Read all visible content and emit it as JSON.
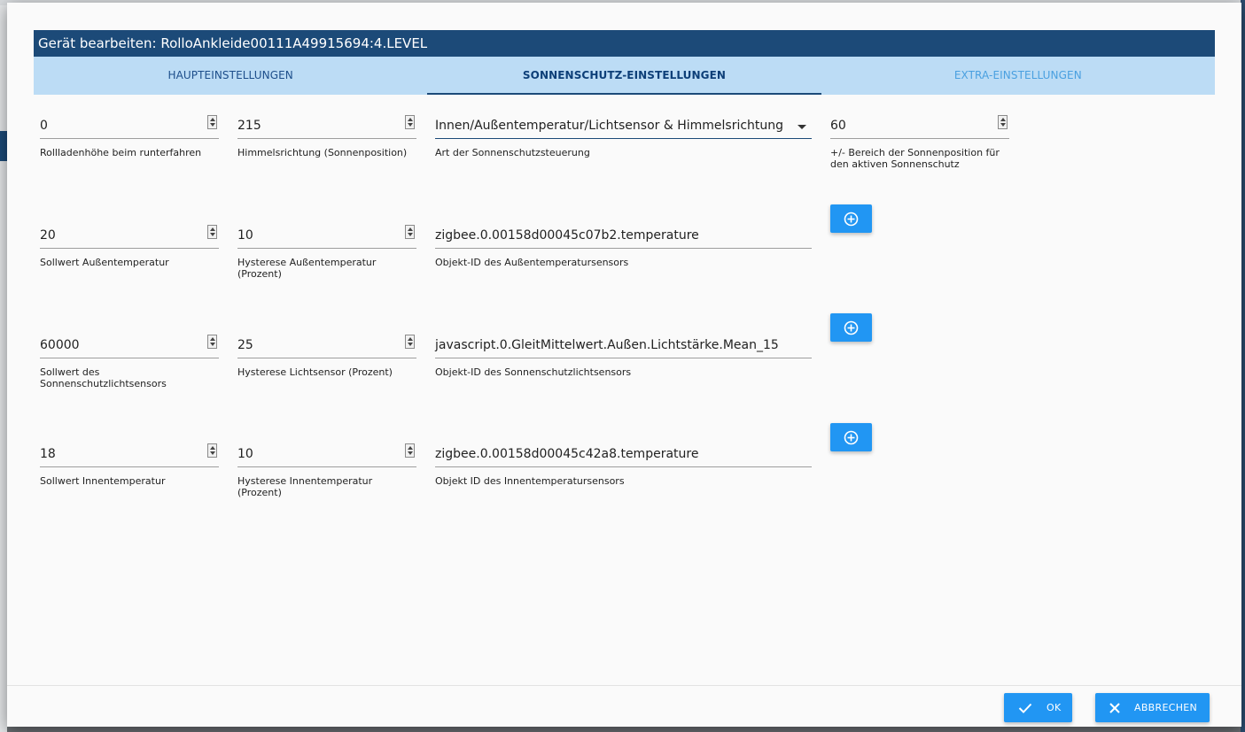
{
  "dialog": {
    "title": "Gerät bearbeiten: RolloAnkleide00111A49915694:4.LEVEL"
  },
  "tabs": [
    {
      "label": "HAUPTEINSTELLUNGEN"
    },
    {
      "label": "SONNENSCHUTZ-EINSTELLUNGEN"
    },
    {
      "label": "EXTRA-EINSTELLUNGEN"
    }
  ],
  "fields": {
    "height_down": {
      "value": "0",
      "label": "Rollladenhöhe beim runterfahren"
    },
    "sun_direction": {
      "value": "215",
      "label": "Himmelsrichtung (Sonnenposition)"
    },
    "sunprotect_mode": {
      "value": "Innen/Außentemperatur/Lichtsensor & Himmelsrichtung",
      "label": "Art der Sonnenschutzsteuerung"
    },
    "sun_range": {
      "value": "60",
      "label": "+/- Bereich der Sonnenposition für den aktiven Sonnenschutz"
    },
    "outside_temp_setpoint": {
      "value": "20",
      "label": "Sollwert Außentemperatur"
    },
    "outside_temp_hysteresis": {
      "value": "10",
      "label": "Hysterese Außentemperatur (Prozent)"
    },
    "outside_temp_sensor": {
      "value": "zigbee.0.00158d00045c07b2.temperature",
      "label": "Objekt-ID des Außentemperatursensors"
    },
    "light_setpoint": {
      "value": "60000",
      "label": "Sollwert des Sonnenschutzlichtsensors"
    },
    "light_hysteresis": {
      "value": "25",
      "label": "Hysterese Lichtsensor (Prozent)"
    },
    "light_sensor": {
      "value": "javascript.0.GleitMittelwert.Außen.Lichtstärke.Mean_15",
      "label": "Objekt-ID des Sonnenschutzlichtsensors"
    },
    "inside_temp_setpoint": {
      "value": "18",
      "label": "Sollwert Innentemperatur"
    },
    "inside_temp_hysteresis": {
      "value": "10",
      "label": "Hysterese Innentemperatur (Prozent)"
    },
    "inside_temp_sensor": {
      "value": "zigbee.0.00158d00045c42a8.temperature",
      "label": "Objekt ID des Innentemperatursensors"
    }
  },
  "buttons": {
    "ok": "OK",
    "cancel": "ABBRECHEN"
  },
  "icons": {
    "add": "add-circle-icon",
    "ok": "check-icon",
    "cancel": "close-icon"
  },
  "colors": {
    "title_bar": "#1c4a78",
    "tab_bar": "#bcdcf5",
    "button": "#2196f3"
  }
}
